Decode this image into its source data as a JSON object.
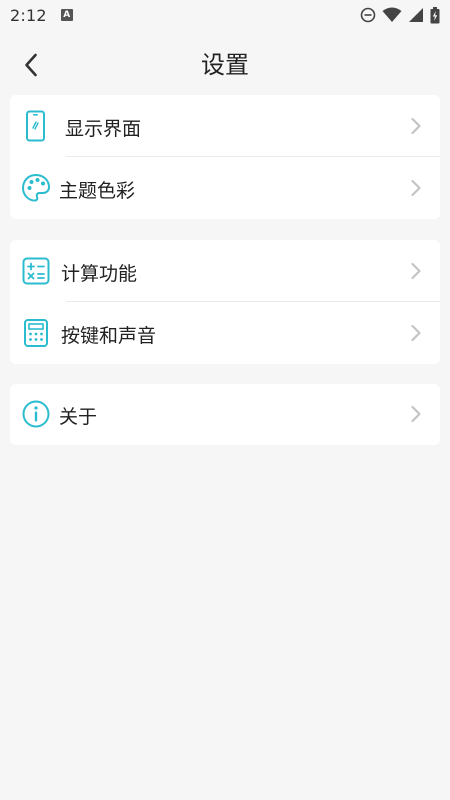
{
  "status_bar": {
    "time": "2:12",
    "badge": "A",
    "icons": [
      "dnd-icon",
      "wifi-icon",
      "signal-icon",
      "battery-icon"
    ]
  },
  "header": {
    "title": "设置",
    "back_icon": "chevron-left-icon"
  },
  "groups": [
    {
      "items": [
        {
          "label": "显示界面",
          "icon": "phone-icon"
        },
        {
          "label": "主题色彩",
          "icon": "palette-icon"
        }
      ]
    },
    {
      "items": [
        {
          "label": "计算功能",
          "icon": "calculator-ops-icon"
        },
        {
          "label": "按键和声音",
          "icon": "keypad-icon"
        }
      ]
    },
    {
      "items": [
        {
          "label": "关于",
          "icon": "info-icon"
        }
      ]
    }
  ],
  "colors": {
    "accent": "#2bbccf",
    "background": "#f6f6f6",
    "card": "#ffffff",
    "chevron": "#c4c4c4",
    "text": "#222222"
  }
}
